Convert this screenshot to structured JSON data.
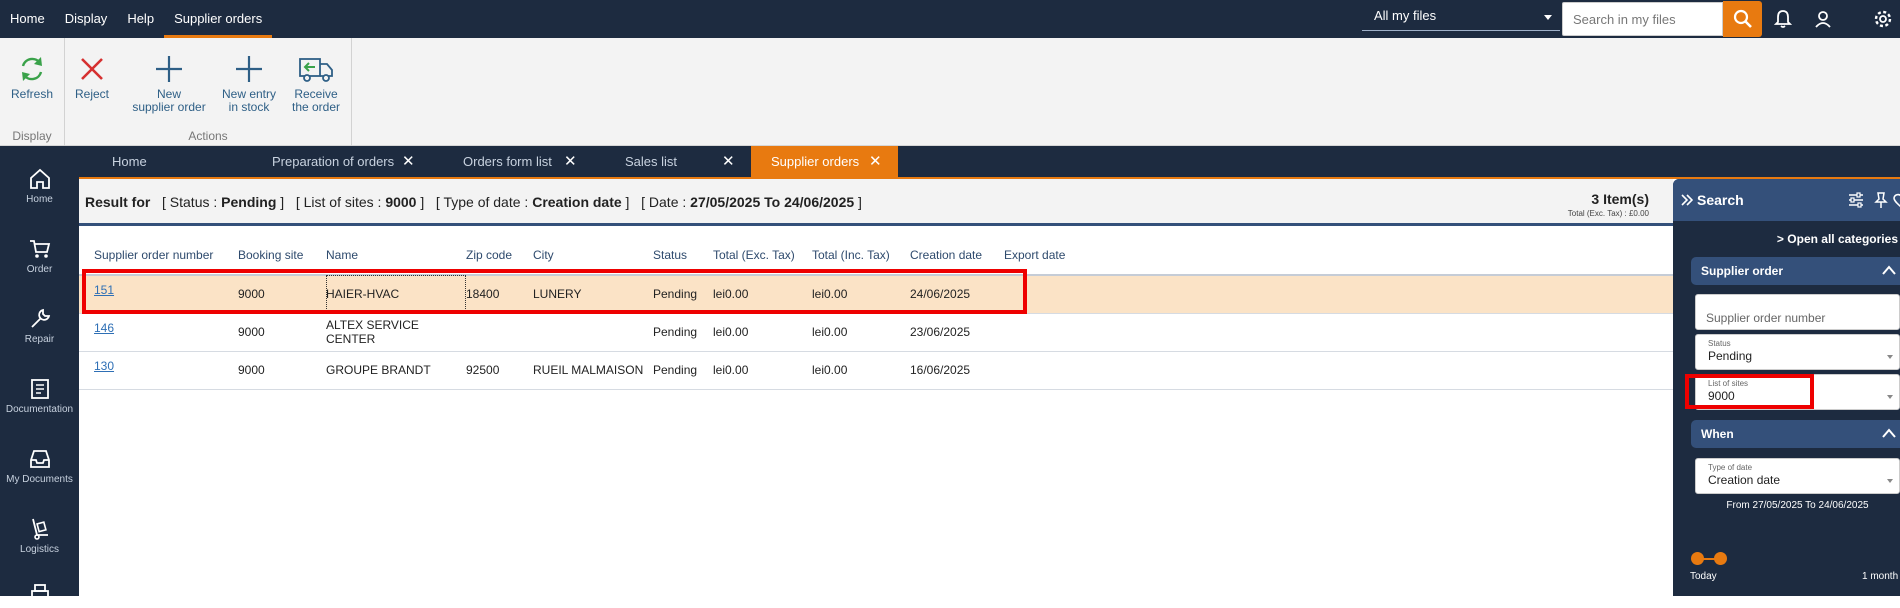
{
  "topnav": {
    "items": [
      "Home",
      "Display",
      "Help",
      "Supplier orders"
    ],
    "active": "Supplier orders",
    "scope": "All my files",
    "search_placeholder": "Search in my files"
  },
  "ribbon": {
    "display_group": {
      "label": "Display",
      "refresh": "Refresh"
    },
    "actions_group": {
      "label": "Actions",
      "reject": "Reject",
      "new_supplier_order": [
        "New",
        "supplier order"
      ],
      "new_entry": [
        "New entry",
        "in stock"
      ],
      "receive": [
        "Receive",
        "the order"
      ]
    }
  },
  "sidebar": {
    "items": [
      "Home",
      "Order",
      "Repair",
      "Documentation",
      "My Documents",
      "Logistics"
    ]
  },
  "tabs": [
    {
      "label": "Home",
      "closable": false
    },
    {
      "label": "Preparation of orders",
      "closable": true
    },
    {
      "label": "Orders form list",
      "closable": true
    },
    {
      "label": "Sales list",
      "closable": true
    },
    {
      "label": "Supplier orders",
      "closable": true,
      "active": true
    }
  ],
  "result": {
    "prefix": "Result for",
    "status_label": "Status :",
    "status_value": "Pending",
    "sites_label": "List of sites :",
    "sites_value": "9000",
    "datetype_label": "Type of date :",
    "datetype_value": "Creation date",
    "date_label": "Date :",
    "date_value": "27/05/2025 To 24/06/2025",
    "items_count": "3 Item(s)",
    "items_total": "Total (Exc. Tax) : £0.00"
  },
  "grid": {
    "columns": [
      "Supplier order number",
      "Booking site",
      "Name",
      "Zip code",
      "City",
      "Status",
      "Total (Exc. Tax)",
      "Total (Inc. Tax)",
      "Creation date",
      "Export date"
    ],
    "rows": [
      [
        "151",
        "9000",
        "HAIER-HVAC",
        "18400",
        "LUNERY",
        "Pending",
        "lei0.00",
        "lei0.00",
        "24/06/2025",
        ""
      ],
      [
        "146",
        "9000",
        "ALTEX SERVICE CENTER",
        "",
        "",
        "Pending",
        "lei0.00",
        "lei0.00",
        "23/06/2025",
        ""
      ],
      [
        "130",
        "9000",
        "GROUPE BRANDT",
        "92500",
        "RUEIL MALMAISON",
        "Pending",
        "lei0.00",
        "lei0.00",
        "16/06/2025",
        ""
      ]
    ],
    "selected_row": 0
  },
  "search_panel": {
    "title": "Search",
    "open_all": "Open all categories",
    "supplier_order_section": "Supplier order",
    "supplier_order_number_placeholder": "Supplier order number",
    "status_label": "Status",
    "status_value": "Pending",
    "sites_label": "List of sites",
    "sites_value": "9000",
    "when_section": "When",
    "datetype_label": "Type of date",
    "datetype_value": "Creation date",
    "date_range": "From 27/05/2025 To 24/06/2025",
    "slider_start": "Today",
    "slider_end": "1 month"
  },
  "colors": {
    "navy": "#1d2b40",
    "accent": "#e87a10",
    "panel_header": "#34507a",
    "selected_row": "#fbe3c6",
    "highlight": "#ee0000"
  }
}
